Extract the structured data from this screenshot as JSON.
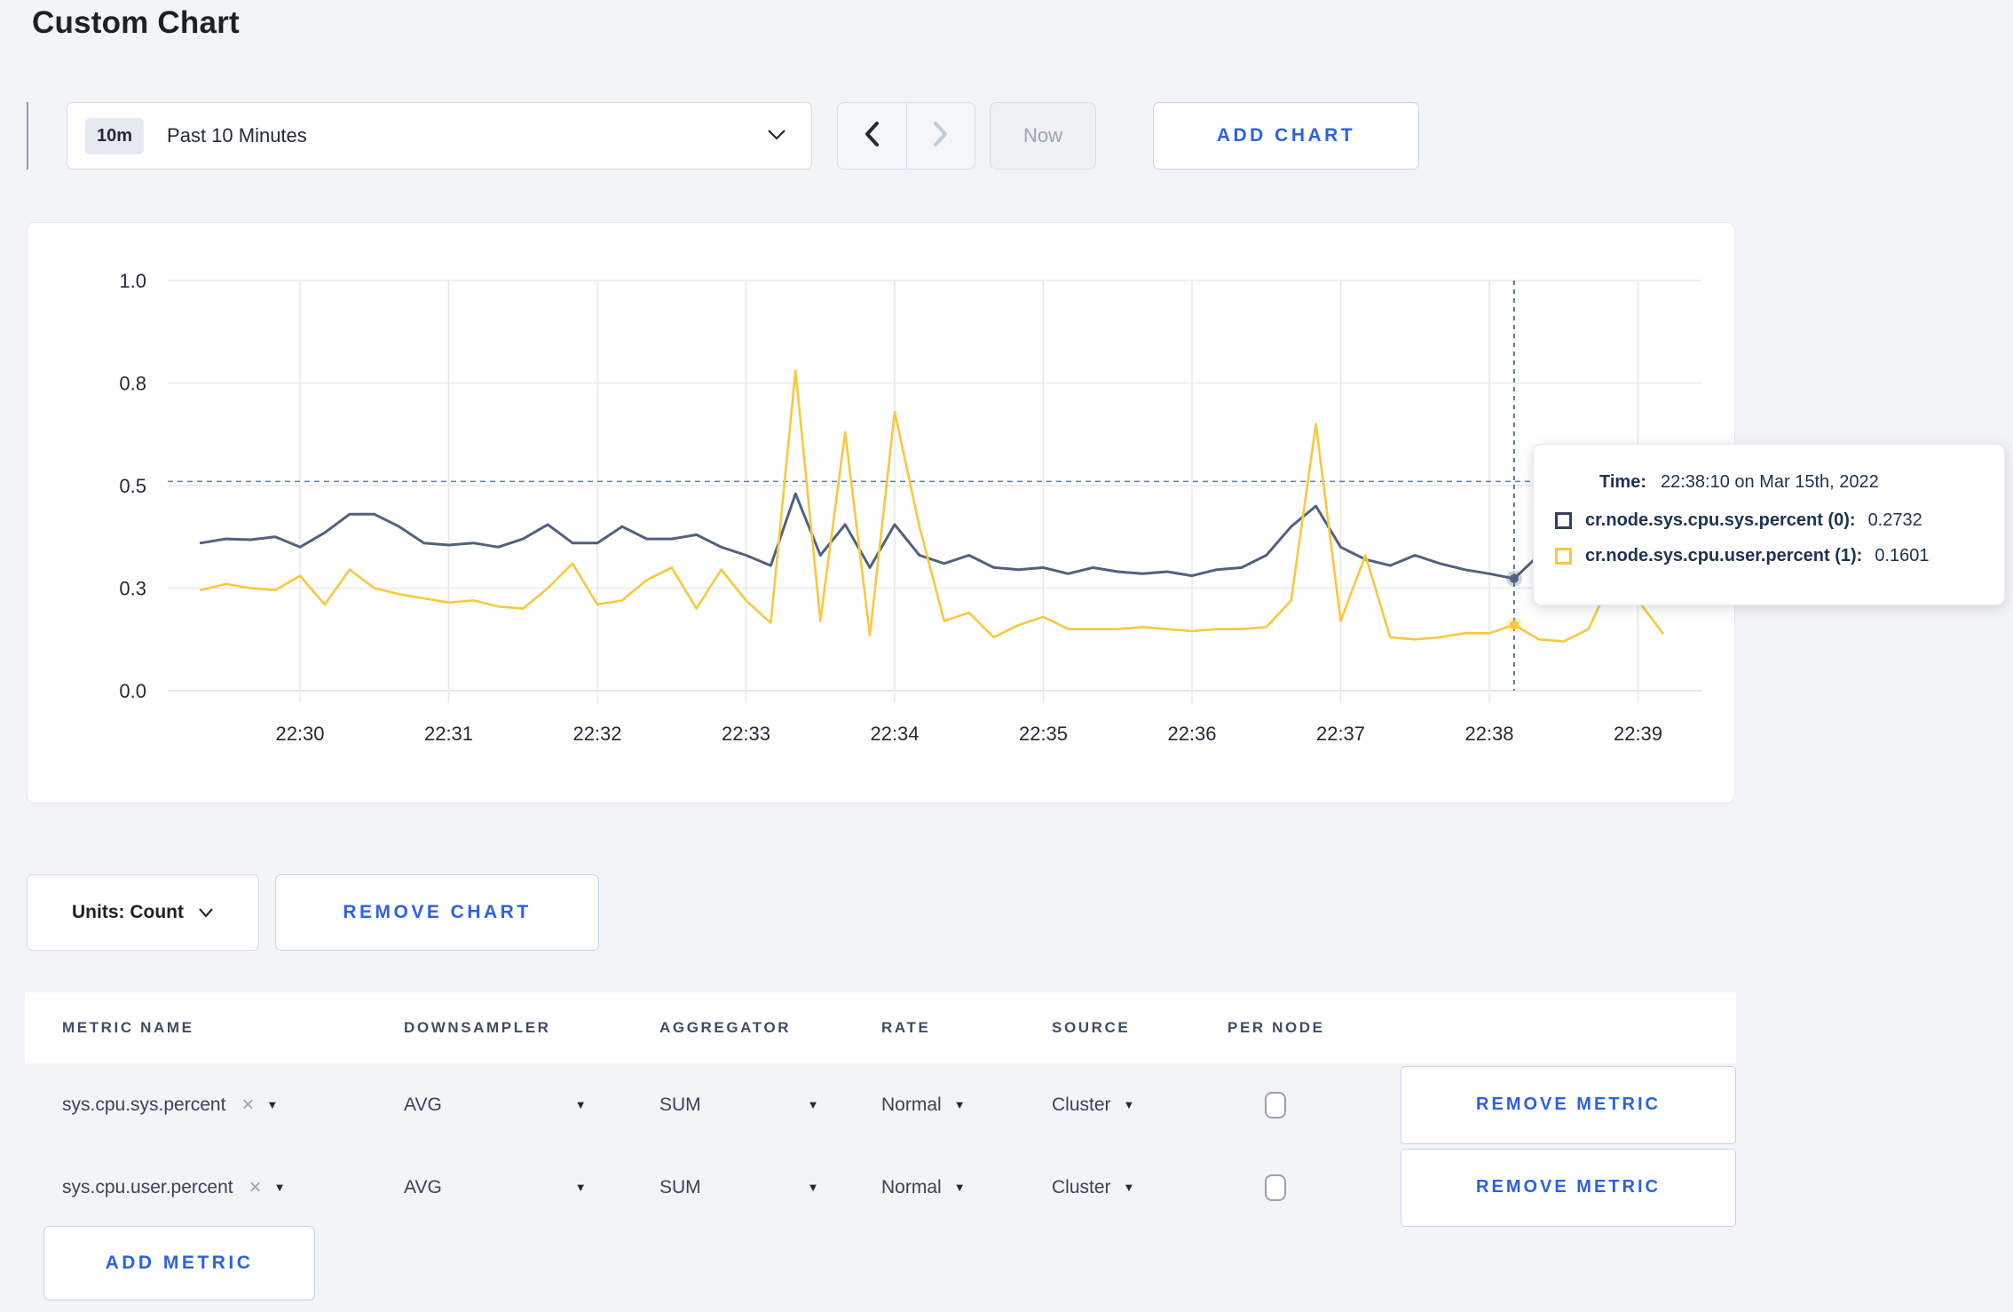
{
  "page": {
    "title": "Custom Chart",
    "background": "#f3f4f8",
    "accent_blue": "#2b61e4"
  },
  "toolbar": {
    "time_badge": "10m",
    "time_range_label": "Past 10 Minutes",
    "now_label": "Now",
    "add_chart_label": "ADD CHART"
  },
  "tooltip": {
    "time_label": "Time:",
    "time_value": "22:38:10 on Mar 15th, 2022",
    "series": [
      {
        "label": "cr.node.sys.cpu.sys.percent (0):",
        "value": "0.2732",
        "color": "#33415f"
      },
      {
        "label": "cr.node.sys.cpu.user.percent (1):",
        "value": "0.1601",
        "color": "#fcc73e"
      }
    ]
  },
  "units_bar": {
    "units_label": "Units: Count",
    "remove_chart_label": "REMOVE CHART"
  },
  "metrics_table": {
    "headers": [
      "METRIC NAME",
      "DOWNSAMPLER",
      "AGGREGATOR",
      "RATE",
      "SOURCE",
      "PER NODE"
    ],
    "rows": [
      {
        "metric": "sys.cpu.sys.percent",
        "downsampler": "AVG",
        "aggregator": "SUM",
        "rate": "Normal",
        "source": "Cluster",
        "per_node_checked": false,
        "remove_label": "REMOVE METRIC"
      },
      {
        "metric": "sys.cpu.user.percent",
        "downsampler": "AVG",
        "aggregator": "SUM",
        "rate": "Normal",
        "source": "Cluster",
        "per_node_checked": false,
        "remove_label": "REMOVE METRIC"
      }
    ],
    "add_metric_label": "ADD METRIC"
  },
  "chart_data": {
    "type": "line",
    "title": "",
    "xlabel": "",
    "ylabel": "",
    "ylim": [
      0,
      1
    ],
    "grid": true,
    "legend": "tooltip-only",
    "x_ticks": [
      "22:30",
      "22:31",
      "22:32",
      "22:33",
      "22:34",
      "22:35",
      "22:36",
      "22:37",
      "22:38",
      "22:39"
    ],
    "y_ticks": [
      {
        "value": 0.0,
        "label": "0.0"
      },
      {
        "value": 0.25,
        "label": "0.3"
      },
      {
        "value": 0.5,
        "label": "0.5"
      },
      {
        "value": 0.75,
        "label": "0.8"
      },
      {
        "value": 1.0,
        "label": "1.0"
      }
    ],
    "x_start": "22:29:20",
    "x_start_offset_seconds": -40,
    "x_step_seconds": 10,
    "series": [
      {
        "name": "cr.node.sys.cpu.sys.percent",
        "color": "#51617f",
        "values": [
          0.36,
          0.37,
          0.368,
          0.375,
          0.35,
          0.385,
          0.43,
          0.43,
          0.4,
          0.36,
          0.355,
          0.36,
          0.35,
          0.37,
          0.405,
          0.36,
          0.36,
          0.4,
          0.37,
          0.37,
          0.38,
          0.35,
          0.33,
          0.305,
          0.48,
          0.33,
          0.405,
          0.3,
          0.405,
          0.33,
          0.31,
          0.33,
          0.3,
          0.295,
          0.3,
          0.285,
          0.3,
          0.29,
          0.285,
          0.29,
          0.28,
          0.295,
          0.3,
          0.33,
          0.4,
          0.45,
          0.35,
          0.32,
          0.305,
          0.33,
          0.31,
          0.295,
          0.285,
          0.2732,
          0.33,
          0.31,
          0.295,
          0.3,
          0.32,
          0.305
        ]
      },
      {
        "name": "cr.node.sys.cpu.user.percent",
        "color": "#fcc73e",
        "values": [
          0.245,
          0.26,
          0.25,
          0.245,
          0.28,
          0.21,
          0.295,
          0.25,
          0.235,
          0.225,
          0.215,
          0.22,
          0.205,
          0.2,
          0.25,
          0.31,
          0.21,
          0.22,
          0.27,
          0.3,
          0.2,
          0.295,
          0.22,
          0.165,
          0.78,
          0.17,
          0.63,
          0.135,
          0.68,
          0.4,
          0.17,
          0.19,
          0.13,
          0.16,
          0.18,
          0.15,
          0.15,
          0.15,
          0.155,
          0.15,
          0.145,
          0.15,
          0.15,
          0.155,
          0.22,
          0.65,
          0.17,
          0.33,
          0.13,
          0.125,
          0.13,
          0.14,
          0.14,
          0.1601,
          0.125,
          0.12,
          0.15,
          0.28,
          0.22,
          0.14
        ]
      }
    ],
    "hover": {
      "index": 53,
      "time": "22:38:10",
      "crosshair_value": 0.51,
      "values": [
        0.2732,
        0.1601
      ]
    }
  }
}
